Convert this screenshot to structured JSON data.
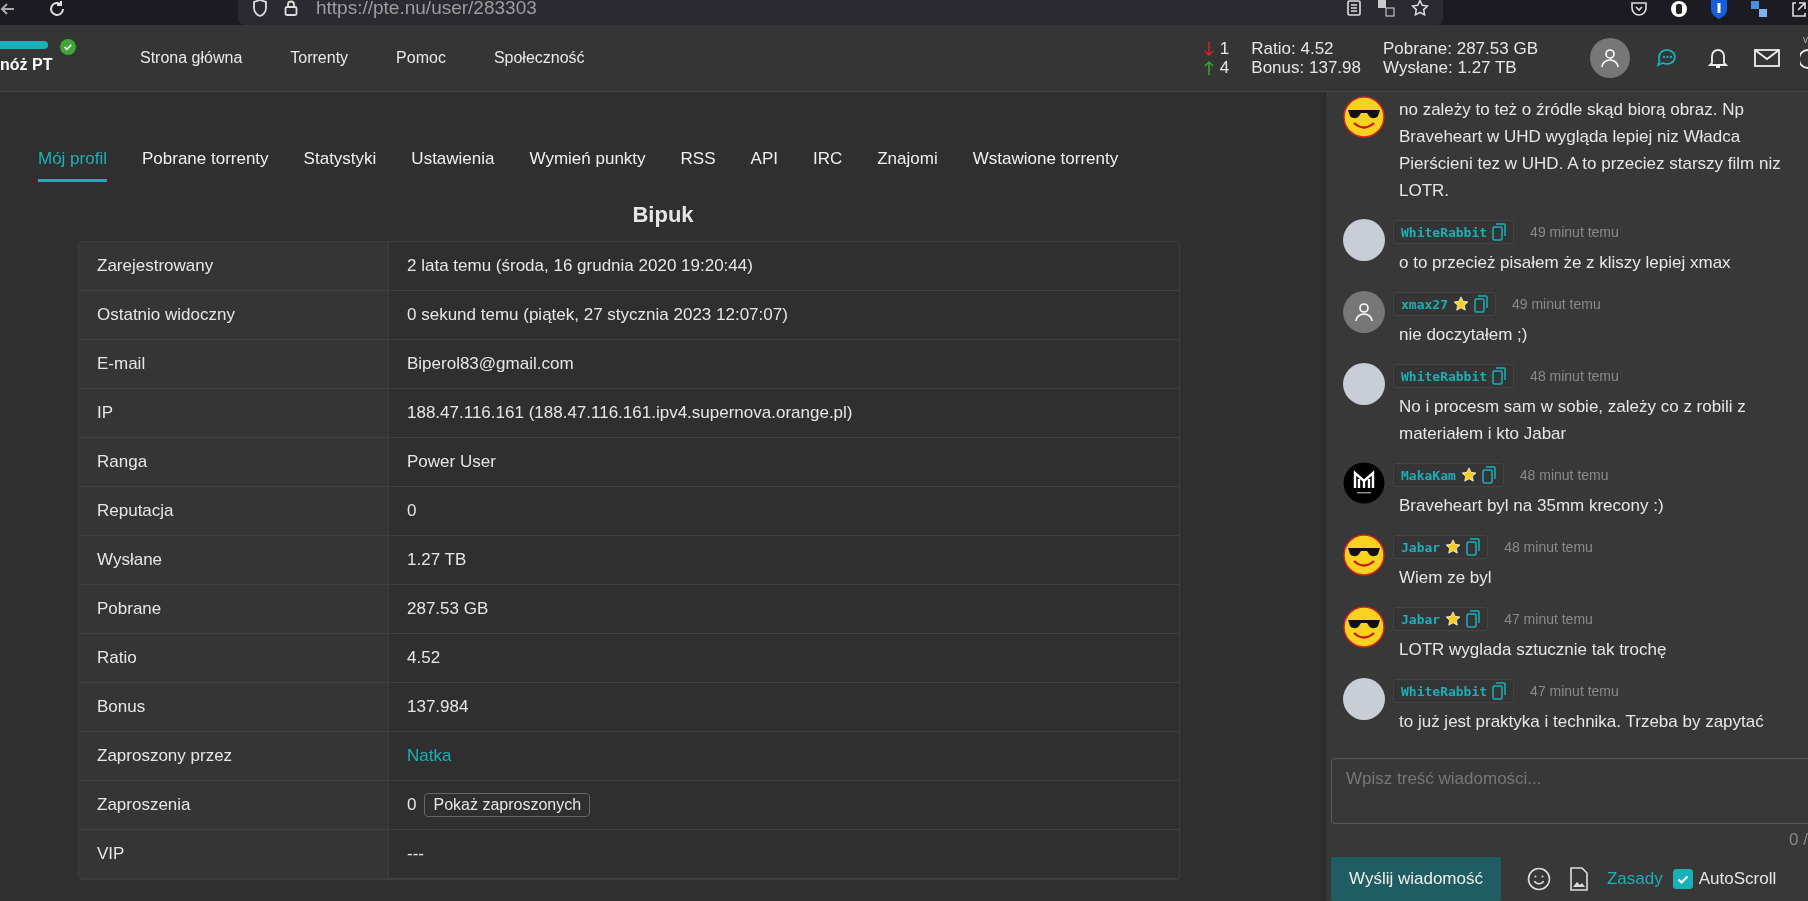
{
  "browser": {
    "url": "https://pte.nu/user/283303"
  },
  "navbar": {
    "logo": "nóż PT",
    "verified": true,
    "items": [
      {
        "label": "Strona główna"
      },
      {
        "label": "Torrenty"
      },
      {
        "label": "Pomoc"
      },
      {
        "label": "Społeczność"
      }
    ],
    "stats": {
      "down_count": "1",
      "up_count": "4",
      "ratio": "Ratio: 4.52",
      "bonus": "Bonus: 137.98",
      "downloaded": "Pobrane: 287.53 GB",
      "uploaded": "Wysłane: 1.27 TB"
    },
    "corner_text": "v"
  },
  "tabs": [
    {
      "label": "Mój profil",
      "selected": true
    },
    {
      "label": "Pobrane torrenty",
      "selected": false
    },
    {
      "label": "Statystyki",
      "selected": false
    },
    {
      "label": "Ustawienia",
      "selected": false
    },
    {
      "label": "Wymień punkty",
      "selected": false
    },
    {
      "label": "RSS",
      "selected": false
    },
    {
      "label": "API",
      "selected": false
    },
    {
      "label": "IRC",
      "selected": false
    },
    {
      "label": "Znajomi",
      "selected": false
    },
    {
      "label": "Wstawione torrenty",
      "selected": false
    }
  ],
  "profile": {
    "title": "Bipuk",
    "rows": [
      {
        "label": "Zarejestrowany",
        "value": "2 lata temu (środa, 16 grudnia 2020 19:20:44)",
        "kind": "text"
      },
      {
        "label": "Ostatnio widoczny",
        "value": "0 sekund temu (piątek, 27 stycznia 2023 12:07:07)",
        "kind": "text"
      },
      {
        "label": "E-mail",
        "value": "Biperol83@gmail.com",
        "kind": "text"
      },
      {
        "label": "IP",
        "value": "188.47.116.161 (188.47.116.161.ipv4.supernova.orange.pl)",
        "kind": "text"
      },
      {
        "label": "Ranga",
        "value": "Power User",
        "kind": "text"
      },
      {
        "label": "Reputacja",
        "value": "0",
        "kind": "text"
      },
      {
        "label": "Wysłane",
        "value": "1.27 TB",
        "kind": "text"
      },
      {
        "label": "Pobrane",
        "value": "287.53 GB",
        "kind": "text"
      },
      {
        "label": "Ratio",
        "value": "4.52",
        "kind": "text"
      },
      {
        "label": "Bonus",
        "value": "137.984",
        "kind": "text"
      },
      {
        "label": "Zaproszony przez",
        "value": "Natka",
        "kind": "link"
      },
      {
        "label": "Zaproszenia",
        "value": "0",
        "kind": "button",
        "button": "Pokaż zaproszonych"
      },
      {
        "label": "VIP",
        "value": "---",
        "kind": "text"
      }
    ]
  },
  "chat": {
    "messages": [
      {
        "kind": "smiley",
        "text": "no zależy to też o źródle skąd biorą obraz. Np Braveheart w UHD wygląda lepiej niz Władca Pierścieni tez w UHD. A to przeciez starszy film niz LOTR."
      },
      {
        "kind": "photo",
        "username": "WhiteRabbit",
        "star": false,
        "time": "49 minut temu",
        "text": "o to przecież pisałem że z kliszy lepiej xmax"
      },
      {
        "kind": "default",
        "username": "xmax27",
        "star": true,
        "time": "49 minut temu",
        "text": "nie doczytałem ;)"
      },
      {
        "kind": "photo",
        "username": "WhiteRabbit",
        "star": false,
        "time": "48 minut temu",
        "text": "No i procesm sam w sobie, zależy co z robili z materiałem i kto Jabar"
      },
      {
        "kind": "logo",
        "username": "MakaKam",
        "star": true,
        "time": "48 minut temu",
        "text": "Braveheart byl na 35mm krecony :)"
      },
      {
        "kind": "smiley",
        "username": "Jabar",
        "star": true,
        "time": "48 minut temu",
        "text": "Wiem ze byl"
      },
      {
        "kind": "smiley",
        "username": "Jabar",
        "star": true,
        "time": "47 minut temu",
        "text": "LOTR wyglada sztucznie tak trochę"
      },
      {
        "kind": "photo",
        "username": "WhiteRabbit",
        "star": false,
        "time": "47 minut temu",
        "text": "to już jest praktyka i technika. Trzeba by zapytać"
      }
    ],
    "input_placeholder": "Wpisz treść wiadomości...",
    "counter": "0 /",
    "send": "Wyślij wiadomość",
    "rules": "Zasady",
    "autoscroll": {
      "label": "AutoScroll",
      "checked": true
    }
  }
}
